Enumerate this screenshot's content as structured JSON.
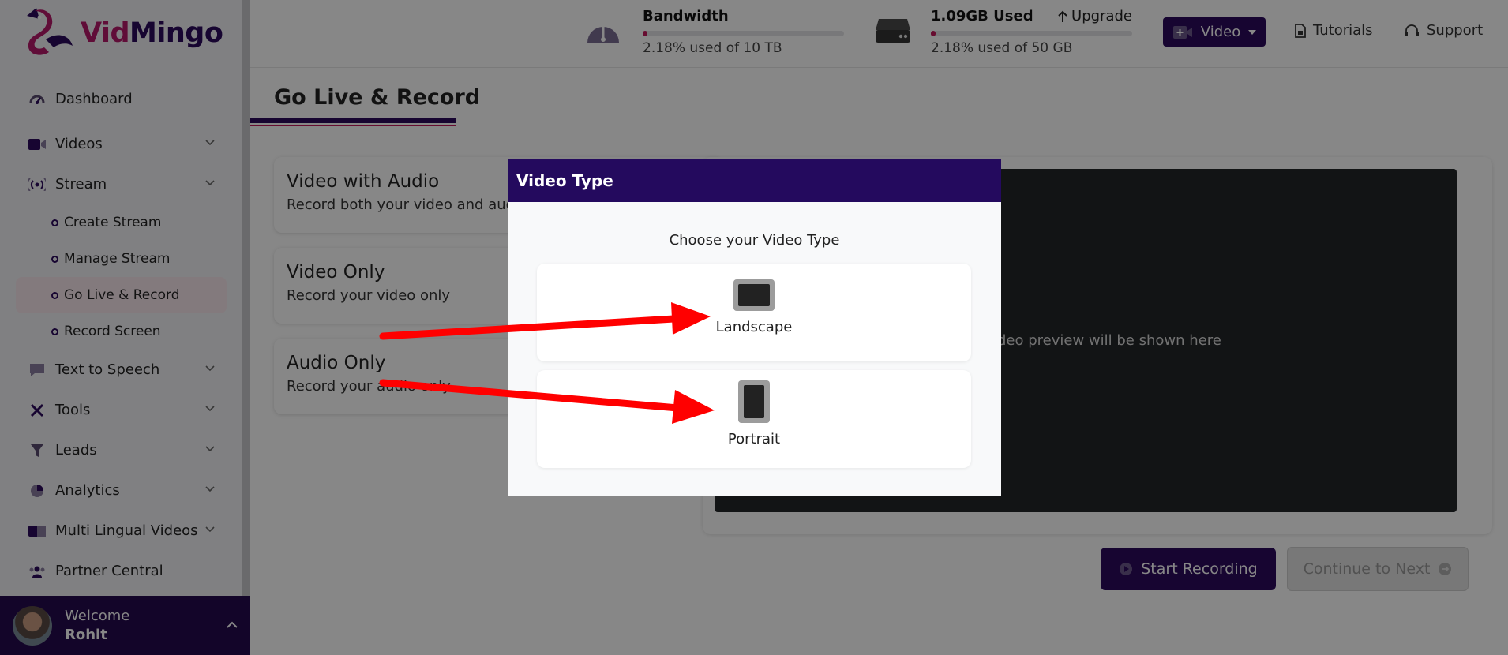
{
  "app": {
    "logo_vid": "Vid",
    "logo_mingo": "Mingo"
  },
  "sidebar": {
    "items": [
      {
        "label": "Dashboard",
        "icon": "dashboard-icon"
      },
      {
        "label": "Videos",
        "icon": "video-camera-icon",
        "expandable": true
      },
      {
        "label": "Stream",
        "icon": "broadcast-icon",
        "expandable": true
      },
      {
        "label": "Text to Speech",
        "icon": "speech-bubble-icon",
        "expandable": true
      },
      {
        "label": "Tools",
        "icon": "tools-icon",
        "expandable": true
      },
      {
        "label": "Leads",
        "icon": "filter-icon",
        "expandable": true
      },
      {
        "label": "Analytics",
        "icon": "pie-chart-icon",
        "expandable": true
      },
      {
        "label": "Multi Lingual Videos",
        "icon": "translate-icon",
        "expandable": true
      },
      {
        "label": "Partner Central",
        "icon": "users-icon"
      }
    ],
    "stream_subitems": [
      {
        "label": "Create Stream"
      },
      {
        "label": "Manage Stream"
      },
      {
        "label": "Go Live & Record",
        "active": true
      },
      {
        "label": "Record Screen"
      }
    ],
    "welcome": {
      "greeting": "Welcome",
      "name": "Rohit"
    }
  },
  "topbar": {
    "bandwidth": {
      "title": "Bandwidth",
      "usage_text": "2.18% used of 10 TB",
      "percent": 2.18
    },
    "storage": {
      "title": "1.09GB Used",
      "usage_text": "2.18% used of 50 GB",
      "percent": 2.18,
      "upgrade_label": "Upgrade"
    },
    "video_button_label": "Video",
    "tutorials_label": "Tutorials",
    "support_label": "Support"
  },
  "main": {
    "page_title": "Go Live & Record",
    "options": [
      {
        "title": "Video with Audio",
        "description": "Record both your video and audio"
      },
      {
        "title": "Video Only",
        "description": "Record your video only"
      },
      {
        "title": "Audio Only",
        "description": "Record your audio only"
      }
    ],
    "preview_text": "Your video preview will be shown here",
    "start_recording_label": "Start Recording",
    "continue_label": "Continue to Next"
  },
  "modal": {
    "title": "Video Type",
    "subtitle": "Choose your Video Type",
    "options": [
      {
        "label": "Landscape",
        "icon": "landscape-icon"
      },
      {
        "label": "Portrait",
        "icon": "portrait-icon"
      }
    ]
  },
  "colors": {
    "brand_dark": "#2d0a5e",
    "brand_pink": "#c2185b",
    "annotation_red": "#ff0000"
  }
}
